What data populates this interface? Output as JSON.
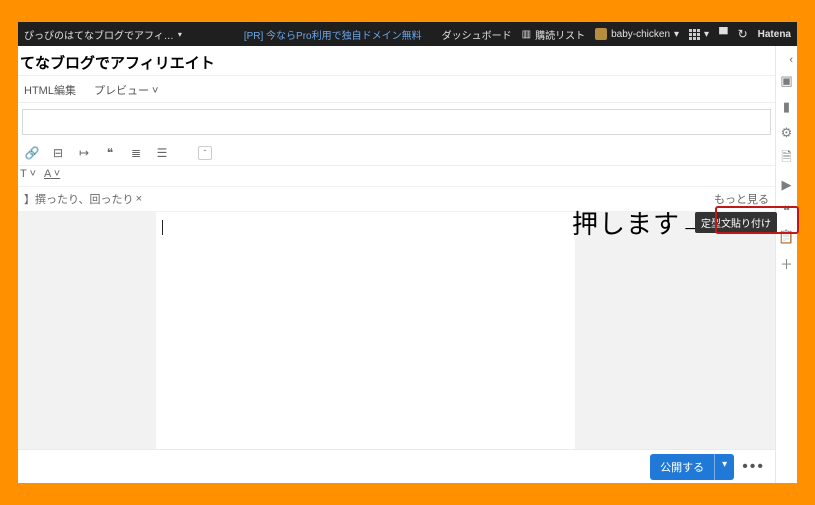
{
  "topbar": {
    "blog_name": "ぴっぴのはてなブログでアフィ…",
    "pr_text": "[PR] 今ならPro利用で独自ドメイン無料",
    "dashboard": "ダッシュボード",
    "reading_list": "購読リスト",
    "username": "baby-chicken",
    "brand": "Hatena"
  },
  "title": "てなブログでアフィリエイト",
  "tabs": {
    "html": "HTML編集",
    "preview": "プレビュー"
  },
  "toolbar2": {
    "t": "T",
    "a": "A"
  },
  "tag_row": {
    "prefix": "】",
    "tag": "撰ったり、回ったり",
    "x": "×",
    "more": "もっと見る"
  },
  "rail_icons": [
    "image",
    "folder",
    "gear",
    "doc",
    "video",
    "quote",
    "clipboard",
    "plus"
  ],
  "tooltip": "定型文貼り付け",
  "annotation": "押します→",
  "footer": {
    "publish": "公開する"
  }
}
